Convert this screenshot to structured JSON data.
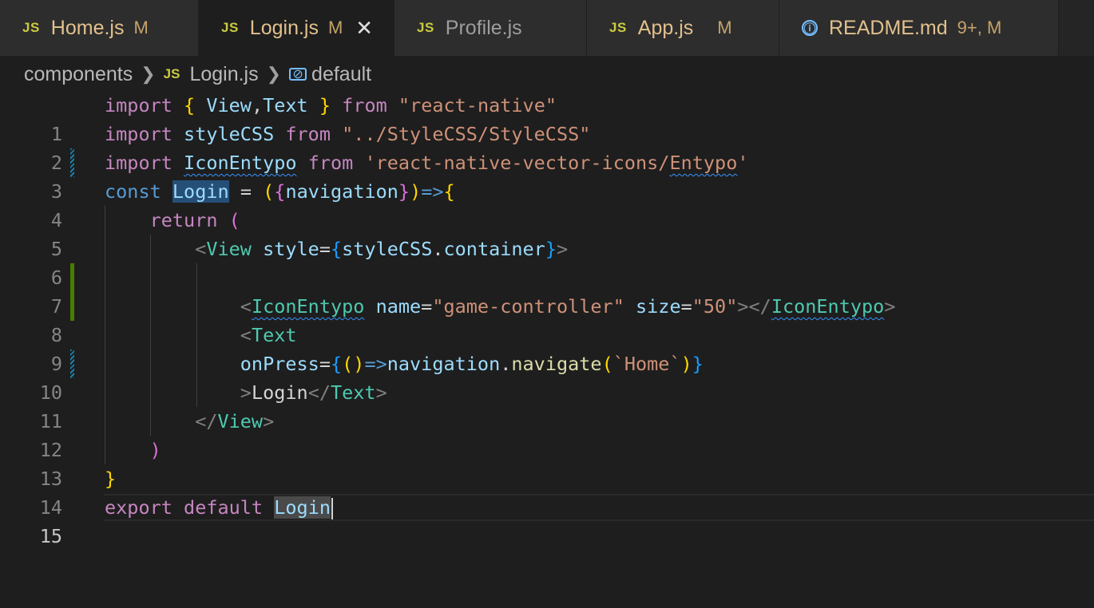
{
  "tabs": [
    {
      "icon": "JS",
      "name": "Home.js",
      "badge": "M"
    },
    {
      "icon": "JS",
      "name": "Login.js",
      "badge": "M",
      "close": "✕"
    },
    {
      "icon": "JS",
      "name": "Profile.js"
    },
    {
      "icon": "JS",
      "name": "App.js",
      "badge": "M"
    },
    {
      "icon": "ⓘ",
      "name": "README.md",
      "badge": "9+, M"
    }
  ],
  "breadcrumb": {
    "folder": "components",
    "file_icon": "JS",
    "file": "Login.js",
    "symbol_icon": "symbol-variable-icon",
    "symbol": "default"
  },
  "editor": {
    "line_numbers": [
      "1",
      "2",
      "3",
      "4",
      "5",
      "6",
      "7",
      "8",
      "9",
      "10",
      "11",
      "12",
      "13",
      "14",
      "15"
    ],
    "current_line": "15",
    "tokens": {
      "import": "import",
      "from": "from",
      "const": "const",
      "return": "return",
      "export": "export",
      "default": "default",
      "View": "View",
      "Text": "Text",
      "styleCSS": "styleCSS",
      "IconEntypo": "IconEntypo",
      "Login": "Login",
      "navigation": "navigation",
      "style": "style",
      "container": "container",
      "name_attr": "name",
      "size_attr": "size",
      "onPress": "onPress",
      "navigate": "navigate",
      "str_rn": "\"react-native\"",
      "str_css": "\"../StyleCSS/StyleCSS\"",
      "str_icons_prefix": "'react-native-vector-icons/",
      "str_icons_entypo": "Entypo",
      "str_icons_suffix": "'",
      "str_game": "\"game-controller\"",
      "str_50": "\"50\"",
      "str_home": "`Home`",
      "text_login": "Login"
    }
  }
}
